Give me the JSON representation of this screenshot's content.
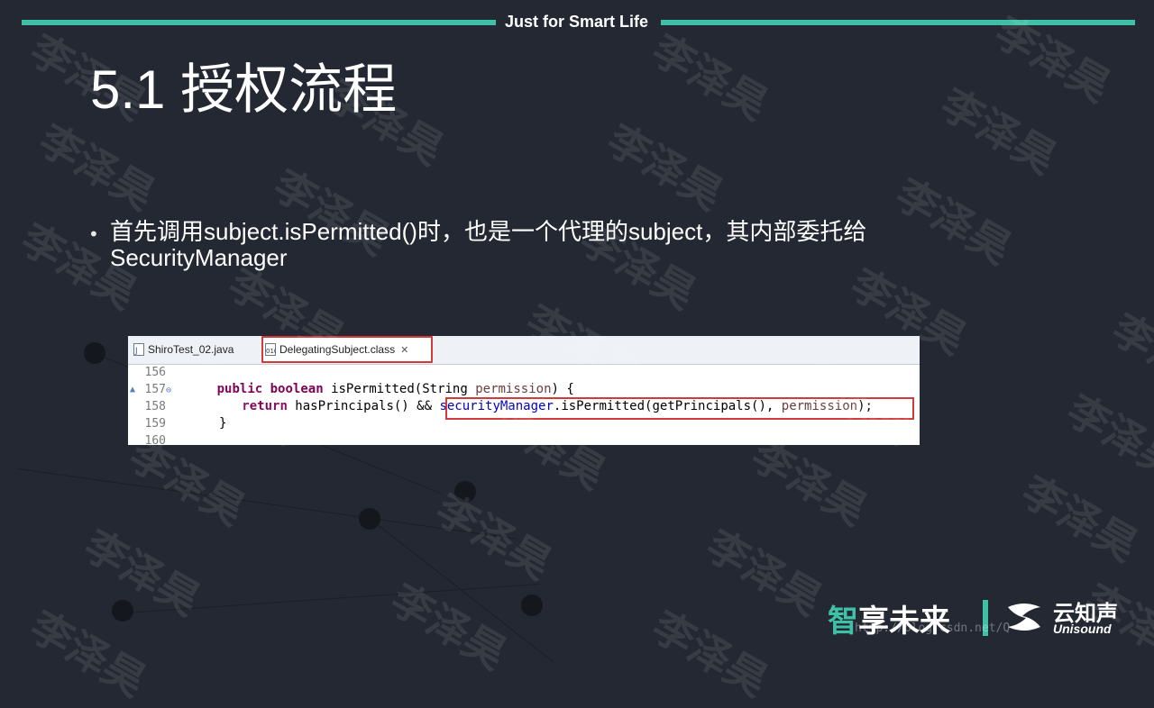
{
  "header": {
    "tagline": "Just for Smart Life"
  },
  "slide": {
    "title": "5.1 授权流程",
    "bullet": "首先调用subject.isPermitted()时，也是一个代理的subject，其内部委托给SecurityManager"
  },
  "ide": {
    "tabs": [
      {
        "label": "ShiroTest_02.java",
        "active": false
      },
      {
        "label": "DelegatingSubject.class",
        "active": true,
        "close": "✕"
      }
    ],
    "lines": [
      {
        "num": "156"
      },
      {
        "num": "157"
      },
      {
        "num": "158"
      },
      {
        "num": "159"
      },
      {
        "num": "160"
      }
    ],
    "code": {
      "l157_kw1": "public",
      "l157_kw2": "boolean",
      "l157_rest": " isPermitted(String ",
      "l157_param": "permission",
      "l157_end": ") {",
      "l158_kw": "return",
      "l158_mid": " hasPrincipals() && ",
      "l158_field": "securityManager",
      "l158_call": ".isPermitted(getPrincipals(), ",
      "l158_param": "permission",
      "l158_end": ");",
      "l159": "}"
    }
  },
  "watermark": {
    "text": "李泽昊"
  },
  "footer": {
    "brand_zhi": "智",
    "brand_rest": "享未来",
    "company_cn": "云知声",
    "company_en": "Unisound",
    "url": "http://blog.csdn.net/Q"
  },
  "colors": {
    "accent": "#3fc1a7",
    "highlight_border": "#d13b3b",
    "background": "#232832"
  }
}
